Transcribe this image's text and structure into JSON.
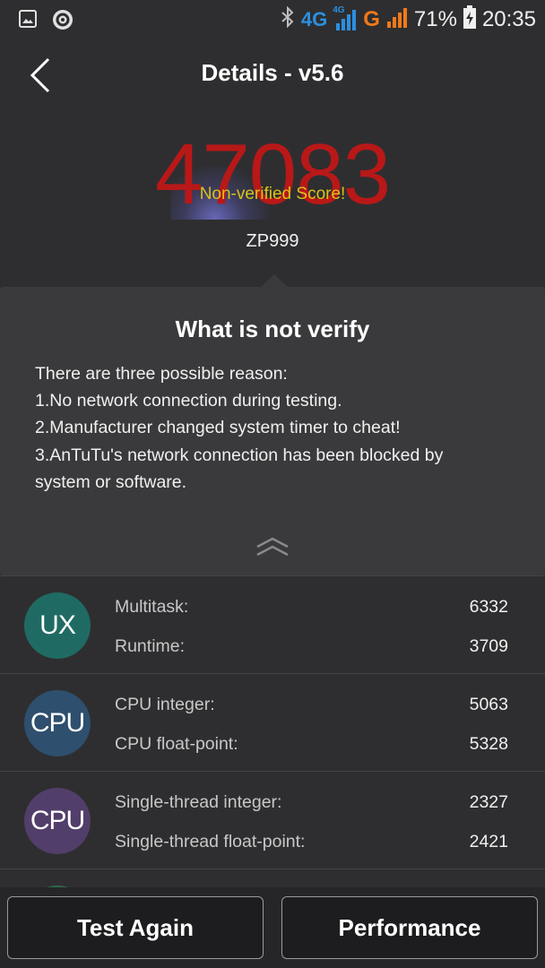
{
  "status_bar": {
    "network_4g": "4G",
    "network_4g_small": "4G",
    "network_g": "G",
    "battery": "71%",
    "time": "20:35",
    "icons": [
      "gallery-icon",
      "app-notification-icon",
      "bluetooth-icon",
      "signal-icon",
      "battery-charging-icon"
    ]
  },
  "header": {
    "title": "Details - v5.6"
  },
  "score": {
    "value": "47083",
    "badge": "Non-verified Score!",
    "device": "ZP999"
  },
  "popup": {
    "title": "What is not verify",
    "lines": [
      "There are three possible reason:",
      "1.No network connection during testing.",
      "2.Manufacturer changed system timer to cheat!",
      "3.AnTuTu's network connection has been blocked by",
      "system or software."
    ]
  },
  "results": [
    {
      "icon_text": "UX",
      "color": "#1f6b63",
      "items": [
        {
          "label": "Multitask:",
          "value": "6332"
        },
        {
          "label": "Runtime:",
          "value": "3709"
        }
      ]
    },
    {
      "icon_text": "CPU",
      "color": "#2e4f6e",
      "items": [
        {
          "label": "CPU integer:",
          "value": "5063"
        },
        {
          "label": "CPU float-point:",
          "value": "5328"
        }
      ]
    },
    {
      "icon_text": "CPU",
      "color": "#523e6a",
      "items": [
        {
          "label": "Single-thread integer:",
          "value": "2327"
        },
        {
          "label": "Single-thread float-point:",
          "value": "2421"
        }
      ]
    }
  ],
  "buttons": {
    "test_again": "Test Again",
    "performance": "Performance"
  },
  "colors": {
    "background": "#2e2e30",
    "score": "#b81818",
    "badge": "#d8c21a",
    "network_blue": "#2b8fe0",
    "network_orange": "#f07a18"
  }
}
